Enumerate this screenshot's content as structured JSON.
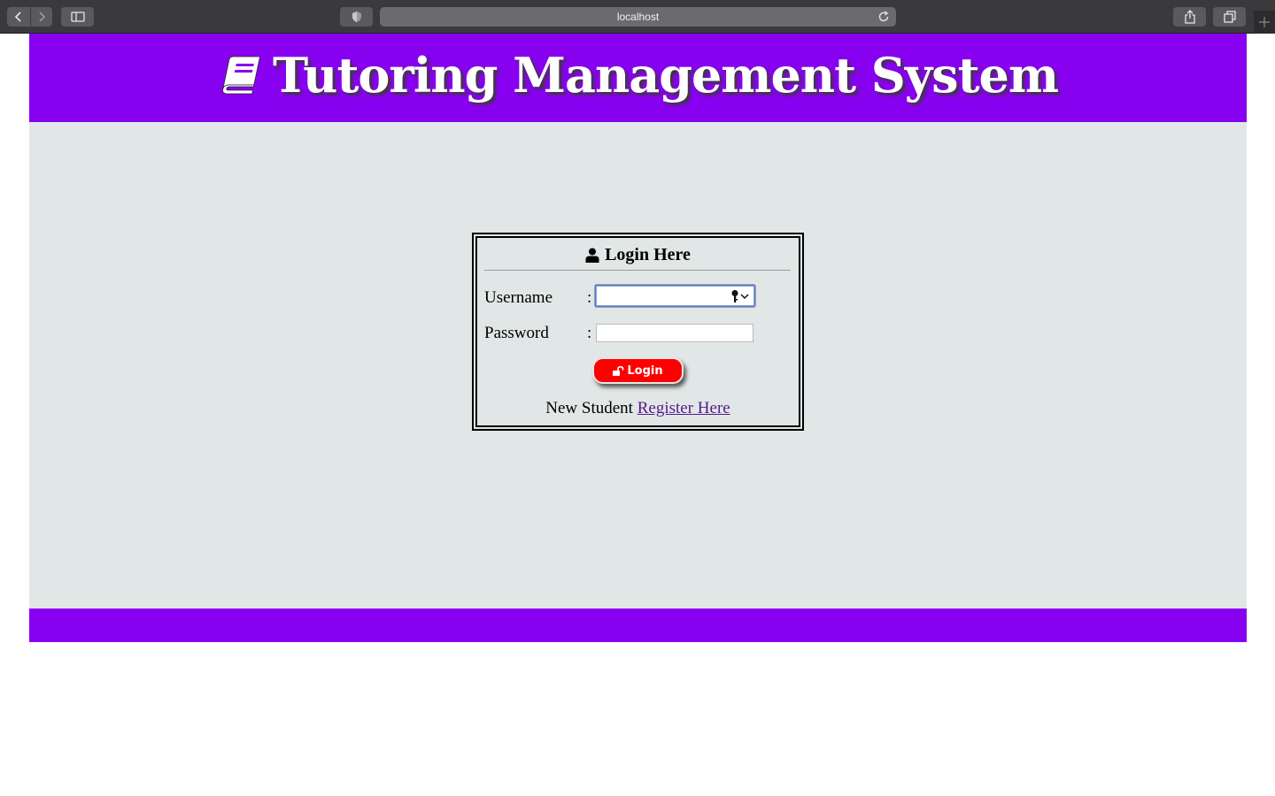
{
  "browser": {
    "url": "localhost"
  },
  "header": {
    "title": "Tutoring Management System",
    "icon": "book-icon"
  },
  "login": {
    "heading": "Login Here",
    "username_label": "Username",
    "password_label": "Password",
    "separator": ":",
    "username_value": "",
    "password_value": "",
    "button_label": "Login",
    "register_prefix": "New Student",
    "register_link": "Register Here"
  },
  "colors": {
    "brand": "#8800f0",
    "content_bg": "#e1e7e6",
    "button": "#ff0000",
    "link": "#551a8b"
  }
}
